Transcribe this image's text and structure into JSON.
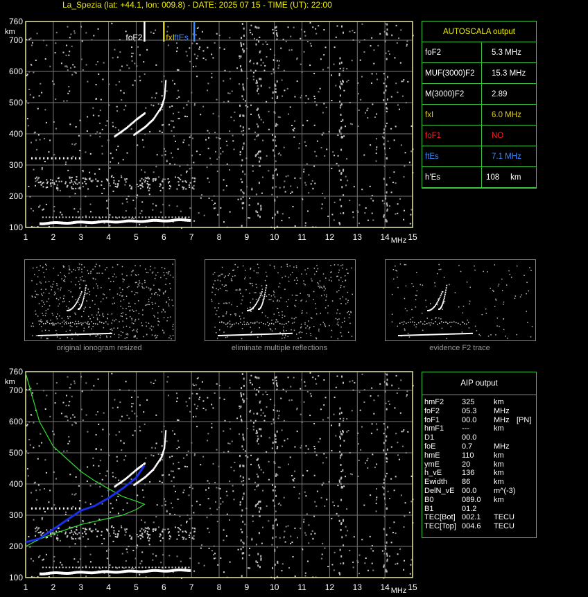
{
  "header": "La_Spezia (lat: +44.1, lon: 009.8) - DATE: 2025 07 15 - TIME (UT): 22:00",
  "colors": {
    "grid": "#7a7a7a",
    "axis": "#e8e8a0",
    "table": "#3ec53e",
    "fof2": "#ffffff",
    "fxi": "#e0d020",
    "ftes": "#3a8cff",
    "nonRed": "#ff2020",
    "profileGreen": "#33dd33",
    "profileBlue": "#1a2fe8"
  },
  "chart_data": [
    {
      "type": "scatter",
      "title": "",
      "xlabel": "MHz",
      "ylabel": "km",
      "xlim": [
        1,
        15
      ],
      "ylim": [
        100,
        760
      ],
      "x_ticks": [
        "1",
        "2",
        "3",
        "4",
        "5",
        "6",
        "7",
        "8",
        "9",
        "10",
        "11",
        "12",
        "13",
        "14",
        "15"
      ],
      "y_ticks": [
        "100",
        "200",
        "300",
        "400",
        "500",
        "600",
        "700",
        "760"
      ],
      "markers": [
        {
          "label": "foF2",
          "x": 5.3,
          "color": "#ffffff"
        },
        {
          "label": "fxI",
          "x": 6.0,
          "color": "#e0d020"
        },
        {
          "label": "ftEs",
          "x": 7.1,
          "color": "#3a8cff"
        }
      ],
      "traces": {
        "f2_o": [
          [
            4.2,
            395
          ],
          [
            4.6,
            420
          ],
          [
            5.0,
            450
          ],
          [
            5.3,
            470
          ]
        ],
        "f2_x": [
          [
            4.9,
            400
          ],
          [
            5.3,
            425
          ],
          [
            5.6,
            450
          ],
          [
            5.9,
            490
          ],
          [
            6.0,
            520
          ],
          [
            6.05,
            575
          ]
        ],
        "es_layer": [
          [
            1.5,
            113
          ],
          [
            3,
            115
          ],
          [
            5,
            120
          ],
          [
            6.9,
            124
          ]
        ],
        "f_low": [
          [
            1.2,
            325
          ],
          [
            3.0,
            325
          ]
        ]
      }
    },
    {
      "type": "line",
      "title": "",
      "xlabel": "MHz",
      "ylabel": "km",
      "xlim": [
        1,
        15
      ],
      "ylim": [
        100,
        760
      ],
      "x_ticks": [
        "1",
        "2",
        "3",
        "4",
        "5",
        "6",
        "7",
        "8",
        "9",
        "10",
        "11",
        "12",
        "13",
        "14",
        "15"
      ],
      "y_ticks": [
        "100",
        "200",
        "300",
        "400",
        "500",
        "600",
        "700",
        "760"
      ],
      "series": [
        {
          "name": "",
          "color": "#33dd33",
          "points": [
            [
              1.0,
              755
            ],
            [
              1.5,
              600
            ],
            [
              2.0,
              520
            ],
            [
              2.5,
              480
            ],
            [
              3.0,
              440
            ],
            [
              3.5,
              410
            ],
            [
              4.0,
              385
            ],
            [
              4.5,
              360
            ],
            [
              5.0,
              345
            ],
            [
              5.3,
              335
            ],
            [
              5.0,
              318
            ],
            [
              4.5,
              300
            ],
            [
              4.0,
              290
            ],
            [
              3.5,
              280
            ],
            [
              3.0,
              270
            ],
            [
              2.5,
              255
            ],
            [
              2.0,
              240
            ],
            [
              1.5,
              223
            ],
            [
              1.0,
              200
            ]
          ]
        },
        {
          "name": "",
          "color": "#1a2fe8",
          "points": [
            [
              1.0,
              213
            ],
            [
              1.5,
              225
            ],
            [
              2.0,
              255
            ],
            [
              2.5,
              285
            ],
            [
              3.0,
              315
            ],
            [
              3.5,
              330
            ],
            [
              4.0,
              355
            ],
            [
              4.5,
              385
            ],
            [
              5.0,
              420
            ],
            [
              5.3,
              460
            ]
          ]
        }
      ]
    }
  ],
  "autoscala": {
    "title": "AUTOSCALA output",
    "rows": [
      {
        "label": "foF2",
        "value": "5.3 MHz",
        "label_color": "#ffffff",
        "value_color": "#ffffff"
      },
      {
        "label": "MUF(3000)F2",
        "value": "15.3 MHz",
        "label_color": "#ffffff",
        "value_color": "#ffffff"
      },
      {
        "label": "M(3000)F2",
        "value": "2.89",
        "label_color": "#ffffff",
        "value_color": "#ffffff"
      },
      {
        "label": "fxI",
        "value": "6.0 MHz",
        "label_color": "#e0d020",
        "value_color": "#e0d020"
      },
      {
        "label": "foF1",
        "value": "NO",
        "label_color": "#ff2020",
        "value_color": "#ff2020"
      },
      {
        "label": "ftEs",
        "value": "7.1 MHz",
        "label_color": "#3a8cff",
        "value_color": "#3a8cff"
      },
      {
        "label": "h'Es",
        "value": "108     km",
        "label_color": "#ffffff",
        "value_color": "#ffffff"
      }
    ]
  },
  "thumbnails": [
    {
      "caption": "original ionogram resized"
    },
    {
      "caption": "eliminate multiple reflections"
    },
    {
      "caption": "evidence F2 trace"
    }
  ],
  "aip": {
    "title": "AIP output",
    "rows": [
      {
        "name": "hmF2",
        "value": "325",
        "unit": "km",
        "extra": ""
      },
      {
        "name": "foF2",
        "value": "05.3",
        "unit": "MHz",
        "extra": ""
      },
      {
        "name": "foF1",
        "value": "00.0",
        "unit": "MHz",
        "extra": "[PN]"
      },
      {
        "name": "hmF1",
        "value": "---",
        "unit": "km",
        "extra": ""
      },
      {
        "name": "D1",
        "value": "00.0",
        "unit": "",
        "extra": ""
      },
      {
        "name": "foE",
        "value": "0.7",
        "unit": "MHz",
        "extra": ""
      },
      {
        "name": "hmE",
        "value": "110",
        "unit": "km",
        "extra": ""
      },
      {
        "name": "ymE",
        "value": "20",
        "unit": "km",
        "extra": ""
      },
      {
        "name": "h_vE",
        "value": "136",
        "unit": "km",
        "extra": ""
      },
      {
        "name": "Ewidth",
        "value": "86",
        "unit": "km",
        "extra": ""
      },
      {
        "name": "DelN_vE",
        "value": "00.0",
        "unit": "m^(-3)",
        "extra": ""
      },
      {
        "name": "B0",
        "value": "089.0",
        "unit": "km",
        "extra": ""
      },
      {
        "name": "B1",
        "value": "01.2",
        "unit": "",
        "extra": ""
      },
      {
        "name": "TEC[Bot]",
        "value": "002.1",
        "unit": "TECU",
        "extra": ""
      },
      {
        "name": "TEC[Top]",
        "value": "004.6",
        "unit": "TECU",
        "extra": ""
      }
    ]
  }
}
